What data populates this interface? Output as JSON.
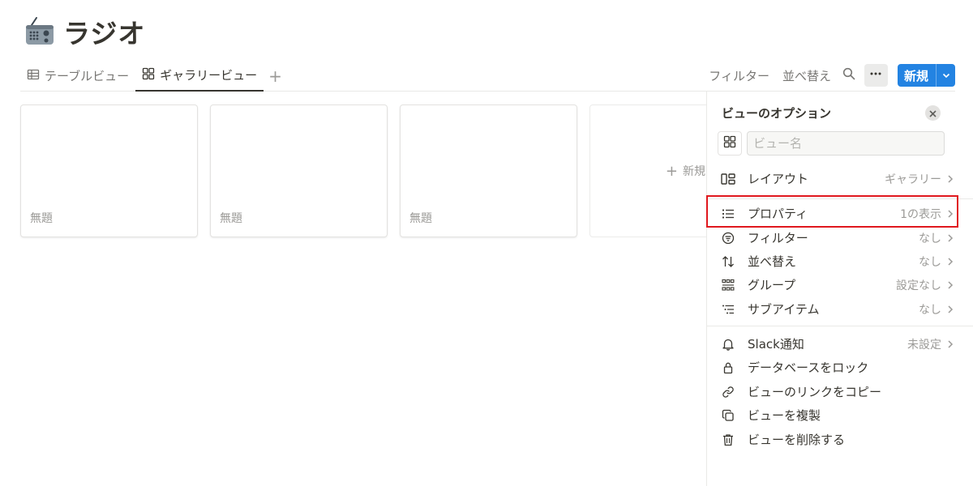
{
  "page": {
    "title": "ラジオ",
    "icon": "radio-icon"
  },
  "tabs": [
    {
      "label": "テーブルビュー",
      "icon": "table-icon",
      "active": false
    },
    {
      "label": "ギャラリービュー",
      "icon": "gallery-icon",
      "active": true
    }
  ],
  "toolbar": {
    "filter_label": "フィルター",
    "sort_label": "並べ替え",
    "new_label": "新規",
    "accent_color": "#2383e2"
  },
  "gallery": {
    "cards": [
      {
        "title": "無題"
      },
      {
        "title": "無題"
      },
      {
        "title": "無題"
      }
    ],
    "new_card_label": "新規"
  },
  "panel": {
    "title": "ビューのオプション",
    "view_name_placeholder": "ビュー名",
    "options": [
      {
        "label": "レイアウト",
        "value": "ギャラリー",
        "icon": "layout-icon"
      },
      {
        "label": "プロパティ",
        "value": "1の表示",
        "icon": "list-icon"
      },
      {
        "label": "フィルター",
        "value": "なし",
        "icon": "filter-icon"
      },
      {
        "label": "並べ替え",
        "value": "なし",
        "icon": "sort-icon"
      },
      {
        "label": "グループ",
        "value": "設定なし",
        "icon": "group-icon"
      },
      {
        "label": "サブアイテム",
        "value": "なし",
        "icon": "subitem-icon"
      }
    ],
    "slack": {
      "label": "Slack通知",
      "value": "未設定",
      "icon": "bell-icon"
    },
    "actions": [
      {
        "label": "データベースをロック",
        "icon": "lock-icon"
      },
      {
        "label": "ビューのリンクをコピー",
        "icon": "link-icon"
      },
      {
        "label": "ビューを複製",
        "icon": "duplicate-icon"
      },
      {
        "label": "ビューを削除する",
        "icon": "trash-icon"
      }
    ]
  },
  "highlight_color": "#e0181e"
}
